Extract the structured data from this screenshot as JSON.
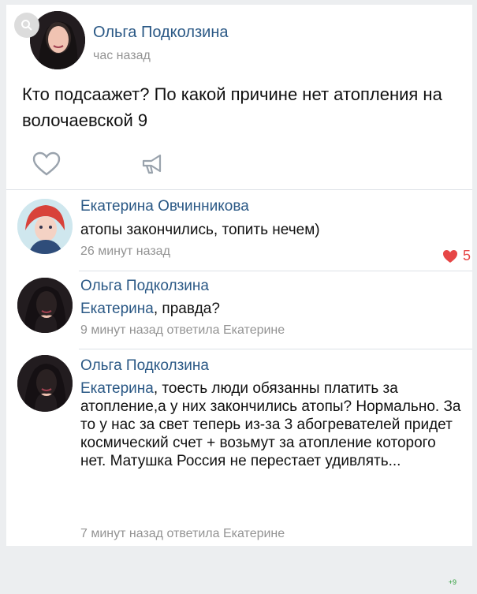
{
  "post": {
    "author": "Ольга Подколзина",
    "time": "час назад",
    "text": "Кто подсаажет? По какой причине нет атопления на волочаевской 9"
  },
  "actions": {
    "like_icon": "heart-outline-icon",
    "share_icon": "megaphone-icon"
  },
  "comments": [
    {
      "author": "Екатерина Овчинникова",
      "text": "атопы закончились, топить нечем)",
      "meta": "26 минут назад",
      "likes": "5"
    },
    {
      "author": "Ольга Подколзина",
      "mention": "Екатерина",
      "text": ", правда?",
      "meta": "9 минут назад ответила Екатерине"
    },
    {
      "author": "Ольга Подколзина",
      "mention": "Екатерина",
      "text": ", тоесть люди обязанны платить за атопление,а у них закончились атопы? Нормально. За то у нас за свет теперь из-за 3 абогревателей придет космический счет + возьмут за атопление которого нет. Матушка Россия не перестает удивлять...",
      "meta": "7 минут назад ответила Екатерине"
    }
  ],
  "badge": "+9",
  "colors": {
    "link": "#2a5885",
    "meta": "#939393",
    "like": "#e64646",
    "badge": "#2f9e3b"
  }
}
